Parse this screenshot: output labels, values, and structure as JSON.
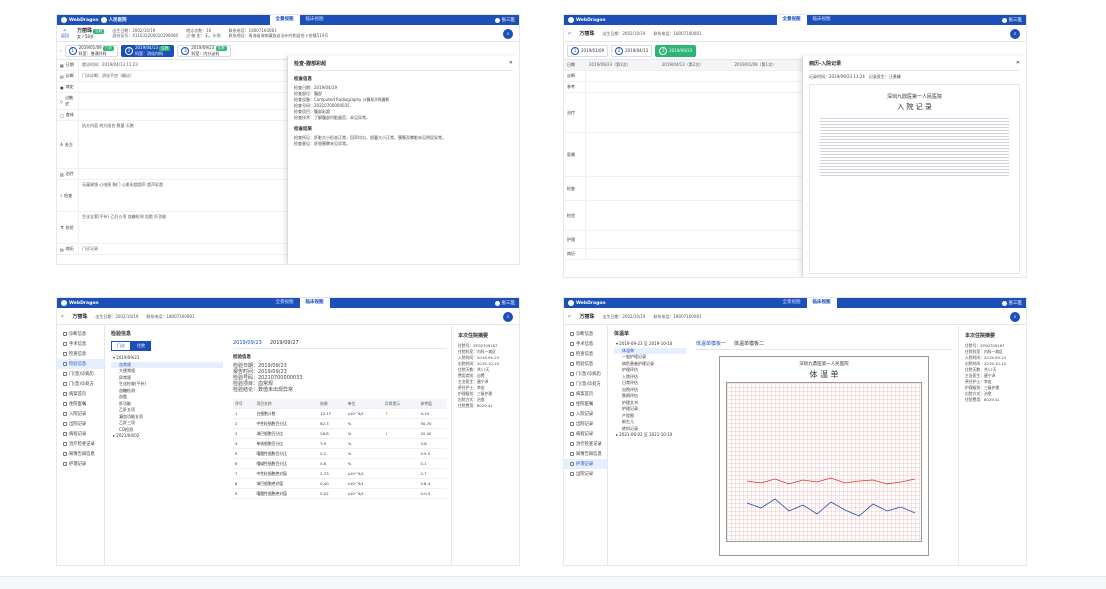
{
  "app": {
    "logo": "WebDragon",
    "hospital": "人民医院",
    "tab_overview": "全景视图",
    "tab_clinical": "临床视图",
    "user": "张三医"
  },
  "patient": {
    "back": "返回",
    "name": "万丽珠",
    "sex_age": "女 / 58岁",
    "badge": "住院",
    "birth": "出生日期：2002/10/19",
    "id": "身份证号：411033200010190000",
    "age": "就诊次数：16",
    "visit": "过 敏 史：无，头孢",
    "phone": "联系电话：18007160081",
    "addr": "联系地址：青海省海南藏族自治州共和县恰卜恰镇514号"
  },
  "s1": {
    "steps": [
      {
        "n": "1",
        "date": "2019/01/09",
        "tag": "门诊",
        "dept": "科室：普通外科"
      },
      {
        "n": "2",
        "date": "2019/04/13",
        "tag": "住院",
        "dept": "科室：消化内科"
      },
      {
        "n": "3",
        "date": "2019/09/23",
        "tag": "住院",
        "dept": "科室：内分泌科"
      }
    ],
    "rows": [
      {
        "l": "日期",
        "v": "就诊时间：2019/04/13 11:23"
      },
      {
        "l": "诊断",
        "v": "门诊诊断：消化不良（确诊）"
      },
      {
        "l": "病史",
        "v": ""
      },
      {
        "l": "过敏史",
        "v": ""
      },
      {
        "l": "查体",
        "v": ""
      },
      {
        "l": "处方",
        "v": "执方内容   剂方组合   数量   天数"
      },
      {
        "l": "治疗",
        "v": ""
      },
      {
        "l": "检查",
        "v": "无痛胃镜  心电图  胸门  心脏彩超超声  超声彩超"
      },
      {
        "l": "检验",
        "v": "生化全套(平补)  乙肝五项  血糖检测  血脂  肝功能"
      },
      {
        "l": "病历",
        "v": "门诊记录"
      }
    ],
    "drawer": {
      "title": "检查-腹部彩超",
      "sec1": "检查信息",
      "k1": "检查日期：2019/04/19",
      "k2": "检查部位：腹部",
      "k3": "检查设备：Computed Radiography 计算机X线摄影",
      "k4": "检查号码：20210700000035",
      "k5": "检查项目：腹部彩超",
      "k6": "检查技术：了解腹部内脏器官，未见异常。",
      "sec2": "检查结果",
      "r1": "检查所见：肝脏大小形态正常，回声均匀，胆囊大小正常，胰腺及脾脏未见明显异常。",
      "r2": "检查意见：肝胆胰脾未见异常。"
    }
  },
  "s2": {
    "cols": [
      "2019/09/23（第3次）",
      "2019/04/13（第2次）",
      "2019/01/09（第1次）"
    ],
    "rows": [
      "日期",
      "诊断",
      "参考",
      "治疗",
      "医嘱",
      "检查",
      "检验",
      "护理",
      "病历"
    ],
    "drawer_title": "病历-入院记录",
    "doc_hospital": "深圳九鼎医第一人民医院",
    "doc_title": "入 院 记 录",
    "doc_date": "记录时间：2019/09/23 11:24",
    "doc_dr": "记录医生：汪景峰"
  },
  "s3": {
    "title": "检验信息",
    "seg": [
      "门诊",
      "住院"
    ],
    "dates": [
      "2019/09/23",
      "2019/09/27"
    ],
    "tree": [
      "2019/09/23",
      "血常规",
      "大便常规",
      "尿常规",
      "生化检查(平补)",
      "血糖检测",
      "血脂",
      "肝功能",
      "乙肝五项",
      "凝血功能五项",
      "乙肝三项",
      "CO检测",
      "2021/04/02"
    ],
    "info": [
      "检验日期：2019/09/23",
      "报告时间：2019/09/23",
      "检验号码：20210700000033",
      "检验项目：血常规",
      "检验结论：数值未出现异常"
    ],
    "head": [
      "序号",
      "项目名称",
      "结果",
      "单位",
      "异常提示",
      "参考值"
    ],
    "table": [
      [
        "1",
        "白细胞计数",
        "10.17",
        "x10^9/L",
        "↑",
        "4-10"
      ],
      [
        "2",
        "中性粒细胞百分比",
        "62.3",
        "%",
        "",
        "50-70"
      ],
      [
        "3",
        "淋巴细胞百分比",
        "26.8",
        "%",
        "↓",
        "20-40"
      ],
      [
        "4",
        "单核细胞百分比",
        "3.9",
        "%",
        "",
        "3-8"
      ],
      [
        "5",
        "嗜酸性细胞百分比",
        "0.2",
        "%",
        "",
        "0.5-5"
      ],
      [
        "6",
        "嗜碱性细胞百分比",
        "0.6",
        "%",
        "",
        "0-1"
      ],
      [
        "7",
        "中性粒细胞绝对值",
        "2.73",
        "x10^9/L",
        "",
        "2-7"
      ],
      [
        "8",
        "淋巴细胞绝对值",
        "0.40",
        "x10^9/L",
        "",
        "0.8-4"
      ],
      [
        "9",
        "嗜酸性细胞绝对值",
        "0.02",
        "x10^9/L",
        "",
        "0-0.5"
      ]
    ]
  },
  "s4": {
    "title": "体温单",
    "tree": [
      "2019-09-23 至 2019-10-10",
      "体温单",
      "一般护理记录",
      "病危患者护理记录",
      "护理评估",
      "入院评估",
      "日常评估",
      "出院评估",
      "跌倒评估",
      "护理文书",
      "护理记录",
      "产程图",
      "新生儿",
      "转科记录",
      "2021-06-02 至 2021-10-10"
    ],
    "sheet_title": "体 温 单",
    "sheet_hospital": "深圳九鼎医第一人民医院",
    "tab1": "体温单模板一",
    "tab2": "体温单模板二"
  },
  "menu": [
    "诊断信息",
    "手术信息",
    "检查信息",
    "检验信息",
    "门(急)诊病历",
    "门(急)诊处方",
    "病案首页",
    "住院医嘱",
    "入院记录",
    "出院记录",
    "病程记录",
    "治疗检查记录",
    "知情告知信息",
    "护理记录",
    "出院记录"
  ],
  "summary": {
    "title": "本次住院摘要",
    "lines": [
      "住院号：ZY00709167",
      "住院科室：内科一病区",
      "入院时间：2019-09-23",
      "出院时间：2019-10-10",
      "住院天数：共17天",
      "费用类别：自费",
      "主治医生：唐宁泽",
      "责任护士：李宏",
      "护理级别：三级护理",
      "出院方式：治愈",
      "住院费用：8029.41"
    ]
  }
}
